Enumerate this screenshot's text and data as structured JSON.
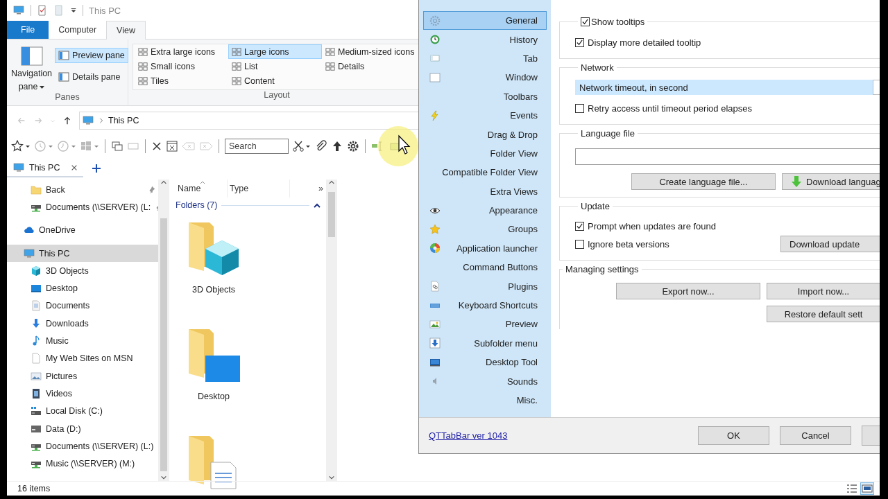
{
  "explorer": {
    "title": "This PC",
    "ribbon_tabs": [
      {
        "label": "File",
        "kind": "file",
        "selected": false
      },
      {
        "label": "Computer",
        "kind": "tab",
        "selected": false
      },
      {
        "label": "View",
        "kind": "tab",
        "selected": true
      }
    ],
    "panes_group": {
      "label": "Panes",
      "navigation_pane": "Navigation pane",
      "items": [
        {
          "label": "Preview pane",
          "selected": true
        },
        {
          "label": "Details pane",
          "selected": false
        }
      ]
    },
    "layout_group": {
      "label": "Layout",
      "items": [
        {
          "label": "Extra large icons",
          "selected": false
        },
        {
          "label": "Small icons",
          "selected": false
        },
        {
          "label": "Tiles",
          "selected": false
        },
        {
          "label": "Large icons",
          "selected": true
        },
        {
          "label": "List",
          "selected": false
        },
        {
          "label": "Content",
          "selected": false
        },
        {
          "label": "Medium-sized icons",
          "selected": false
        },
        {
          "label": "Details",
          "selected": false
        }
      ]
    },
    "address": {
      "path": "This PC"
    },
    "search": {
      "placeholder": "Search"
    },
    "tabs": [
      {
        "label": "This PC",
        "selected": true
      }
    ],
    "navigation": {
      "pinned": [
        {
          "label": "Back",
          "kind": "folder",
          "pinned": true
        },
        {
          "label": "Documents (\\\\SERVER) (L:",
          "kind": "network-drive",
          "pinned": true
        }
      ],
      "items": [
        {
          "label": "OneDrive",
          "kind": "cloud",
          "selected": false
        },
        {
          "label": "This PC",
          "kind": "computer",
          "selected": true,
          "children": [
            {
              "label": "3D Objects",
              "kind": "cube",
              "selected": false
            },
            {
              "label": "Desktop",
              "kind": "desktop",
              "selected": false
            },
            {
              "label": "Documents",
              "kind": "documents",
              "selected": false
            },
            {
              "label": "Downloads",
              "kind": "downloads",
              "selected": false
            },
            {
              "label": "Music",
              "kind": "music",
              "selected": false
            },
            {
              "label": "My Web Sites on MSN",
              "kind": "page",
              "selected": false
            },
            {
              "label": "Pictures",
              "kind": "pictures",
              "selected": false
            },
            {
              "label": "Videos",
              "kind": "videos",
              "selected": false
            },
            {
              "label": "Local Disk (C:)",
              "kind": "system-drive",
              "selected": false
            },
            {
              "label": "Data (D:)",
              "kind": "drive",
              "selected": false
            },
            {
              "label": "Documents (\\\\SERVER) (L:)",
              "kind": "network-drive",
              "selected": false
            },
            {
              "label": "Music (\\\\SERVER) (M:)",
              "kind": "network-drive",
              "selected": false
            }
          ]
        }
      ]
    },
    "columns": [
      "Name",
      "Type"
    ],
    "more_columns": "»",
    "group": {
      "label": "Folders (7)",
      "expanded": true
    },
    "folders": [
      {
        "label": "3D Objects",
        "kind": "cube"
      },
      {
        "label": "Desktop",
        "kind": "desktop"
      },
      {
        "kind": "documents"
      }
    ],
    "status": "16 items",
    "view_buttons": [
      {
        "kind": "details",
        "selected": false
      },
      {
        "kind": "large-icons",
        "selected": true
      }
    ]
  },
  "options_dialog": {
    "nav": [
      {
        "label": "General",
        "kind": "gear",
        "selected": true
      },
      {
        "label": "History",
        "kind": "history",
        "selected": false
      },
      {
        "label": "Tab",
        "kind": "tab",
        "selected": false
      },
      {
        "label": "Window",
        "kind": "window",
        "selected": false
      },
      {
        "label": "Toolbars",
        "kind": "plain",
        "selected": false
      },
      {
        "label": "Events",
        "kind": "lightning",
        "selected": false
      },
      {
        "label": "Drag & Drop",
        "kind": "plain",
        "selected": false
      },
      {
        "label": "Folder View",
        "kind": "plain",
        "selected": false
      },
      {
        "label": "Compatible Folder View",
        "kind": "plain",
        "selected": false
      },
      {
        "label": "Extra Views",
        "kind": "plain",
        "selected": false
      },
      {
        "label": "Appearance",
        "kind": "eye",
        "selected": false
      },
      {
        "label": "Groups",
        "kind": "star",
        "selected": false
      },
      {
        "label": "Application launcher",
        "kind": "orb",
        "selected": false
      },
      {
        "label": "Command Buttons",
        "kind": "plain",
        "selected": false
      },
      {
        "label": "Plugins",
        "kind": "plugin",
        "selected": false
      },
      {
        "label": "Keyboard Shortcuts",
        "kind": "keyboard",
        "selected": false
      },
      {
        "label": "Preview",
        "kind": "image",
        "selected": false
      },
      {
        "label": "Subfolder menu",
        "kind": "download",
        "selected": false
      },
      {
        "label": "Desktop Tool",
        "kind": "monitor",
        "selected": false
      },
      {
        "label": "Sounds",
        "kind": "speaker",
        "selected": false
      },
      {
        "label": "Misc.",
        "kind": "plain",
        "selected": false
      }
    ],
    "tooltips": {
      "label": "Show tooltips",
      "checked": true,
      "detail": {
        "label": "Display more detailed tooltip",
        "checked": true
      }
    },
    "network": {
      "title": "Network",
      "timeout": {
        "label": "Network timeout, in second",
        "selected": true
      },
      "retry": {
        "label": "Retry access until timeout period elapses",
        "checked": false
      }
    },
    "language": {
      "title": "Language file",
      "buttons": [
        {
          "label": "Create language file...",
          "kind": "plain"
        },
        {
          "label": "Download languag",
          "kind": "download"
        }
      ]
    },
    "update": {
      "title": "Update",
      "checks": [
        {
          "label": "Prompt when updates are found",
          "checked": true
        },
        {
          "label": "Ignore beta versions",
          "checked": false
        }
      ],
      "button": "Download update"
    },
    "managing": {
      "title": "Managing settings",
      "buttons": [
        "Export now...",
        "Import now...",
        "Restore default sett"
      ]
    },
    "version_link": "QTTabBar ver 1043",
    "buttons": [
      "OK",
      "Cancel"
    ]
  }
}
